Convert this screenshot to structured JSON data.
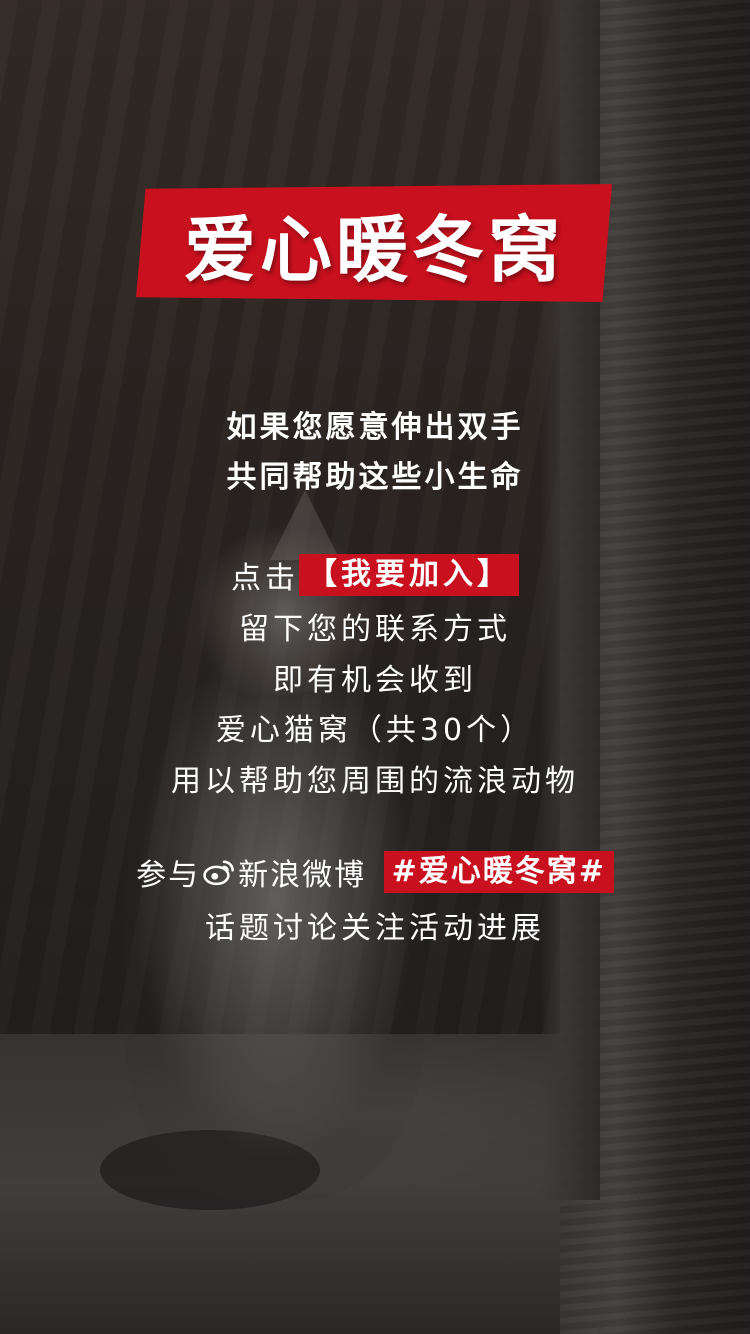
{
  "title": "爱心暖冬窝",
  "intro": {
    "line1": "如果您愿意伸出双手",
    "line2": "共同帮助这些小生命"
  },
  "join": {
    "prefix": "点击",
    "cta": "【我要加入】"
  },
  "body_lines": {
    "line1": "留下您的联系方式",
    "line2": "即有机会收到",
    "line3": "爱心猫窝（共30个）",
    "line4": "用以帮助您周围的流浪动物"
  },
  "weibo": {
    "prefix": "参与",
    "platform": "新浪微博",
    "hashtag": "#爱心暖冬窝#",
    "suffix": "话题讨论关注活动进展",
    "icon": "weibo-icon"
  },
  "colors": {
    "accent": "#c8101e",
    "text": "#ffffff"
  }
}
